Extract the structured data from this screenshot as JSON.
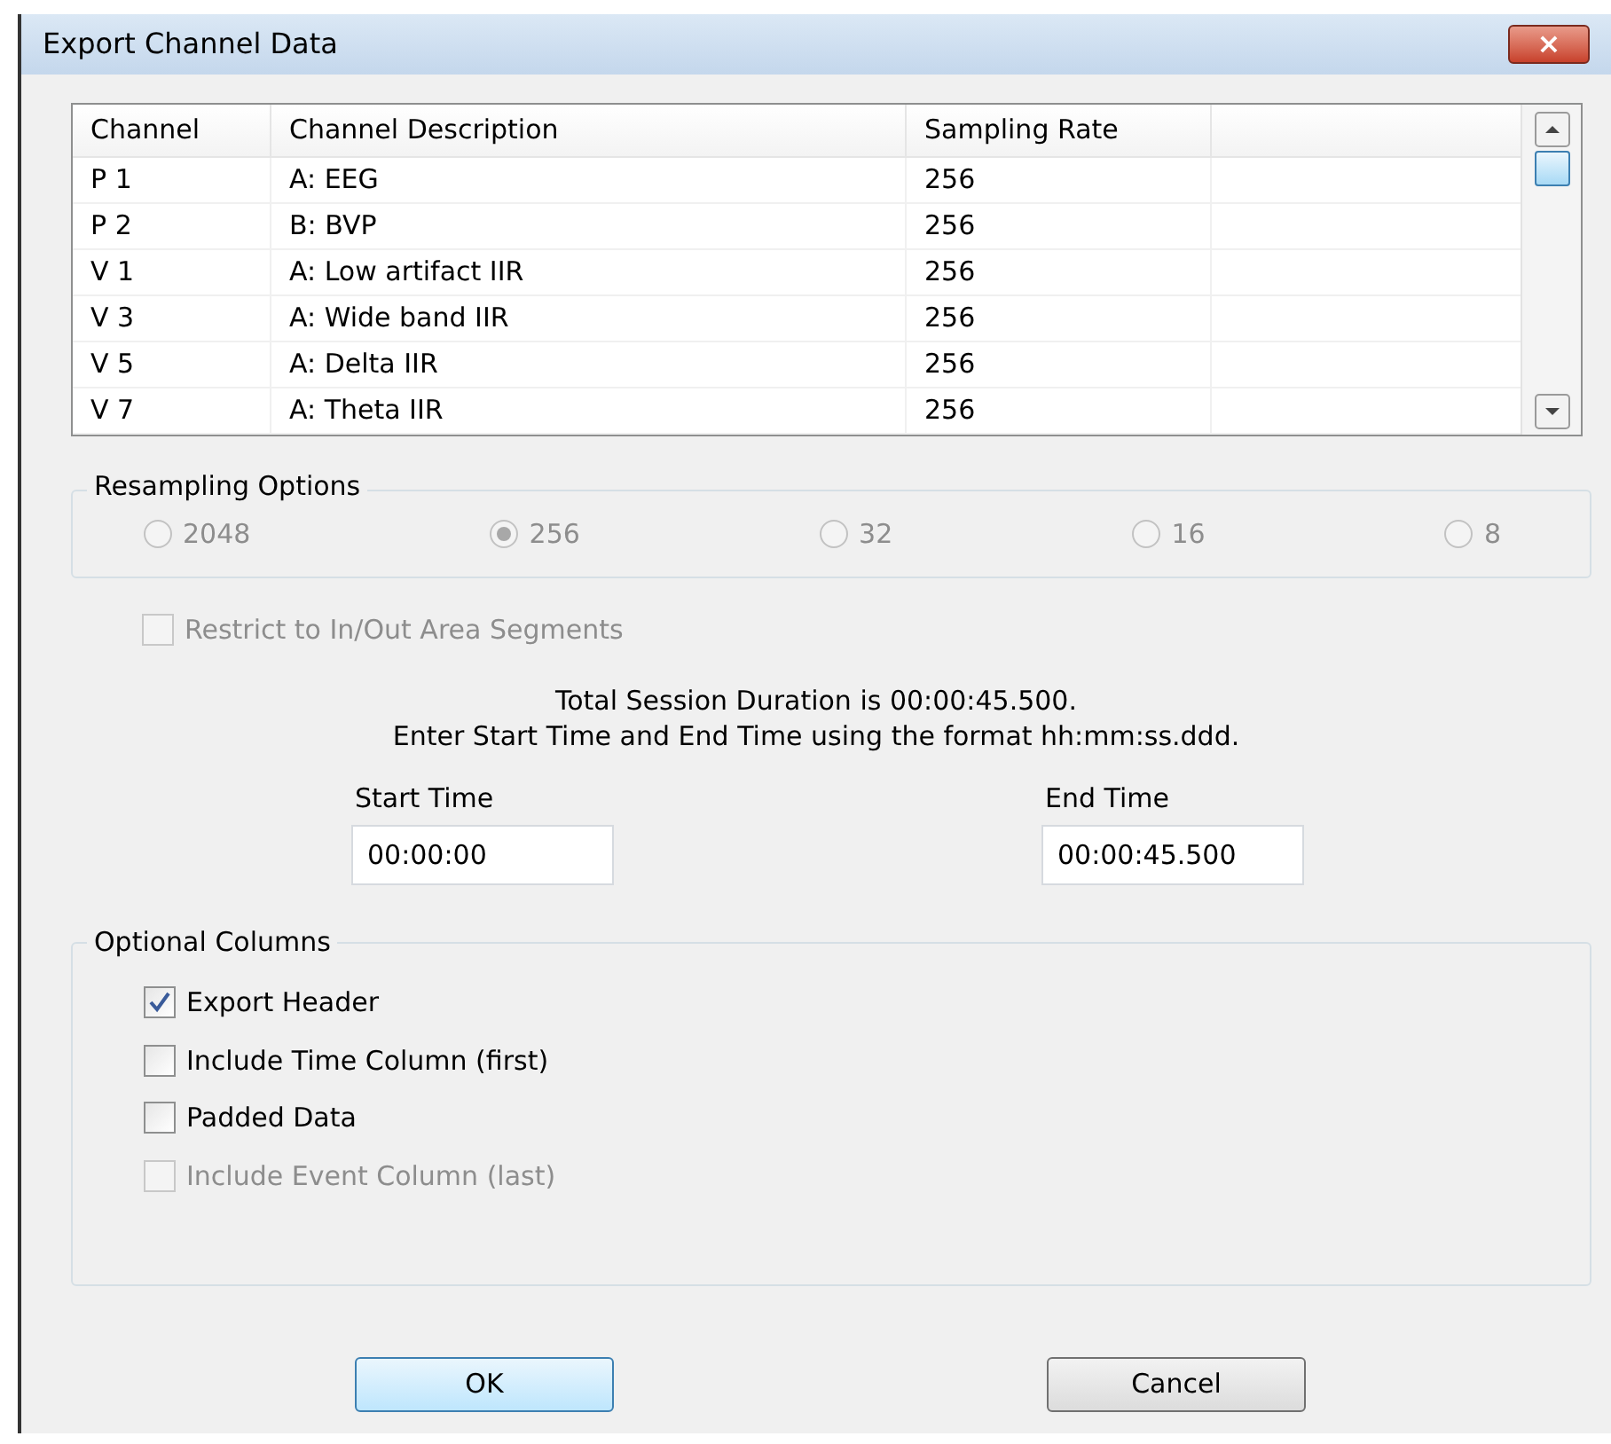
{
  "window": {
    "title": "Export Channel Data",
    "close": "×"
  },
  "table": {
    "columns": [
      "Channel",
      "Channel Description",
      "Sampling Rate"
    ],
    "rows": [
      {
        "channel": "P 1",
        "description": "A: EEG",
        "rate": "256"
      },
      {
        "channel": "P 2",
        "description": "B: BVP",
        "rate": "256"
      },
      {
        "channel": "V 1",
        "description": "A: Low artifact IIR",
        "rate": "256"
      },
      {
        "channel": "V 3",
        "description": "A: Wide band IIR",
        "rate": "256"
      },
      {
        "channel": "V 5",
        "description": "A: Delta IIR",
        "rate": "256"
      },
      {
        "channel": "V 7",
        "description": "A: Theta IIR",
        "rate": "256"
      }
    ]
  },
  "resampling": {
    "title": "Resampling Options",
    "options": [
      {
        "label": "2048",
        "selected": false,
        "disabled": true
      },
      {
        "label": "256",
        "selected": true,
        "disabled": true
      },
      {
        "label": "32",
        "selected": false,
        "disabled": true
      },
      {
        "label": "16",
        "selected": false,
        "disabled": true
      },
      {
        "label": "8",
        "selected": false,
        "disabled": true
      }
    ]
  },
  "restrict": {
    "label": "Restrict to In/Out Area Segments",
    "checked": false,
    "disabled": true
  },
  "info": [
    "Total Session Duration is 00:00:45.500.",
    "Enter Start Time and End Time using the format hh:mm:ss.ddd."
  ],
  "start_time": {
    "label": "Start Time",
    "value": "00:00:00"
  },
  "end_time": {
    "label": "End Time",
    "value": "00:00:45.500"
  },
  "optional_columns": {
    "title": "Optional Columns",
    "items": [
      {
        "label": "Export Header",
        "checked": true,
        "disabled": false
      },
      {
        "label": "Include Time Column (first)",
        "checked": false,
        "disabled": false
      },
      {
        "label": "Padded Data",
        "checked": false,
        "disabled": false
      },
      {
        "label": "Include Event Column (last)",
        "checked": false,
        "disabled": true
      }
    ]
  },
  "buttons": [
    {
      "label": "OK",
      "kind": "default"
    },
    {
      "label": "Cancel",
      "kind": "normal"
    }
  ]
}
